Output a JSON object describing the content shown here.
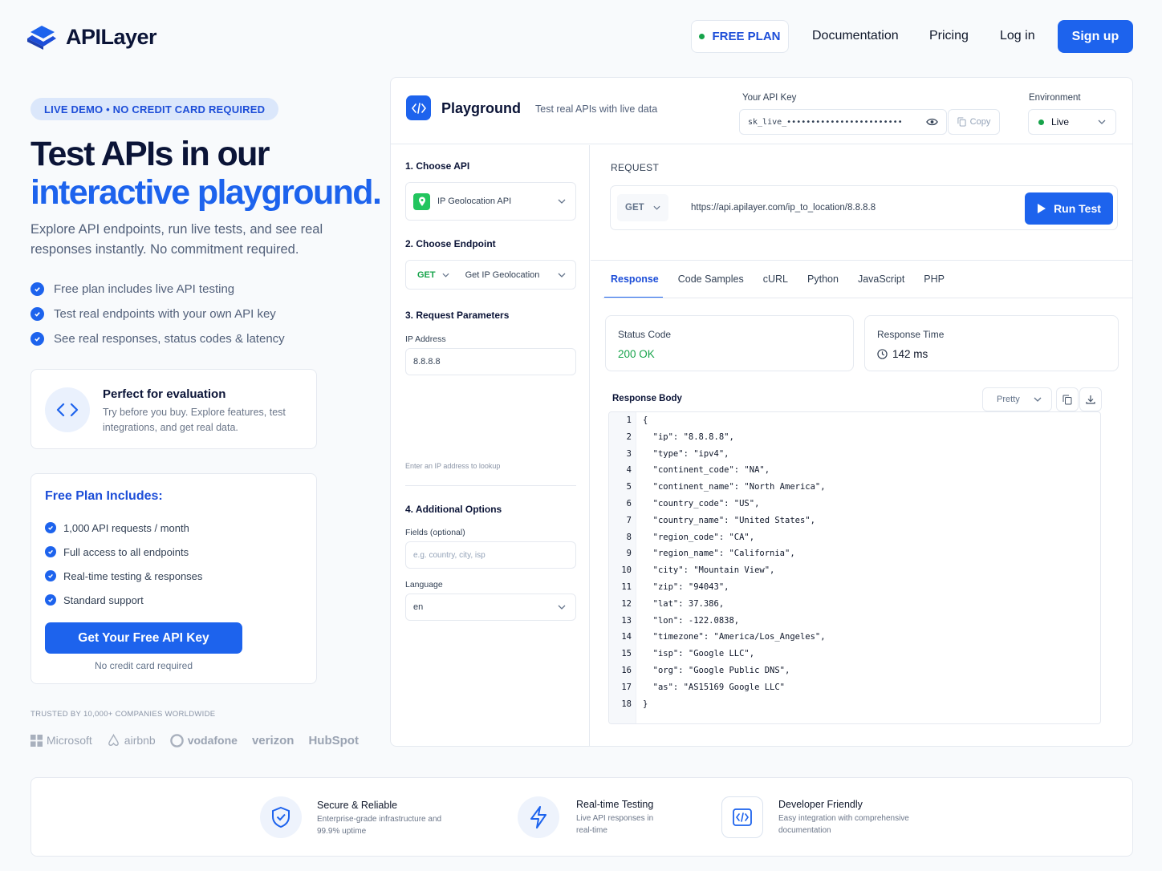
{
  "header": {
    "brand": "APILayer",
    "free_plan": "FREE PLAN",
    "nav": [
      "Documentation",
      "Pricing",
      "Log in"
    ],
    "signup": "Sign up"
  },
  "hero": {
    "badge": "LIVE DEMO • NO CREDIT CARD REQUIRED",
    "title_line1": "Test APIs in our",
    "title_line2": "interactive playground.",
    "lead": "Explore API endpoints, run live tests, and see real responses instantly. No commitment required.",
    "bullets": [
      "Free plan includes live API testing",
      "Test real endpoints with your own API key",
      "See real responses, status codes & latency"
    ]
  },
  "evaluation": {
    "title": "Perfect for evaluation",
    "desc": "Try before you buy. Explore features, test integrations, and get real data."
  },
  "plan": {
    "title": "Free Plan Includes:",
    "items": [
      "1,000 API requests / month",
      "Full access to all endpoints",
      "Real-time testing & responses",
      "Standard support"
    ],
    "cta": "Get Your Free API Key",
    "note": "No credit card required"
  },
  "trusted": {
    "label": "TRUSTED BY 10,000+ COMPANIES WORLDWIDE",
    "brands": [
      "Microsoft",
      "airbnb",
      "vodafone",
      "verizon",
      "HubSpot"
    ]
  },
  "playground": {
    "title": "Playground",
    "subtitle": "Test real APIs with live data",
    "api_key_label": "Your API Key",
    "api_key_value": "sk_live_••••••••••••••••••••••••",
    "copy": "Copy",
    "env_label": "Environment",
    "env_value": "Live",
    "step1": "1. Choose API",
    "api_value": "IP Geolocation API",
    "step2": "2. Choose Endpoint",
    "endpoint_method": "GET",
    "endpoint_value": "Get IP Geolocation",
    "step3": "3. Request Parameters",
    "ip_label": "IP Address",
    "ip_value": "8.8.8.8",
    "ip_hint": "Enter an IP address to lookup",
    "step4": "4. Additional Options",
    "fields_label": "Fields (optional)",
    "fields_placeholder": "e.g. country, city, isp",
    "language_label": "Language",
    "language_value": "en",
    "request_label": "REQUEST",
    "request_method": "GET",
    "request_url": "https://api.apilayer.com/ip_to_location/8.8.8.8",
    "run": "Run Test",
    "tabs": [
      "Response",
      "Code Samples",
      "cURL",
      "Python",
      "JavaScript",
      "PHP"
    ],
    "status_label": "Status Code",
    "status_value": "200 OK",
    "time_label": "Response Time",
    "time_value": "142 ms",
    "body_label": "Response Body",
    "format": "Pretty",
    "code_lines": [
      "{",
      "  \"ip\": \"8.8.8.8\",",
      "  \"type\": \"ipv4\",",
      "  \"continent_code\": \"NA\",",
      "  \"continent_name\": \"North America\",",
      "  \"country_code\": \"US\",",
      "  \"country_name\": \"United States\",",
      "  \"region_code\": \"CA\",",
      "  \"region_name\": \"California\",",
      "  \"city\": \"Mountain View\",",
      "  \"zip\": \"94043\",",
      "  \"lat\": 37.386,",
      "  \"lon\": -122.0838,",
      "  \"timezone\": \"America/Los_Angeles\",",
      "  \"isp\": \"Google LLC\",",
      "  \"org\": \"Google Public DNS\",",
      "  \"as\": \"AS15169 Google LLC\"",
      "}"
    ]
  },
  "features": [
    {
      "title": "Secure & Reliable",
      "desc": "Enterprise-grade infrastructure and 99.9% uptime",
      "icon": "shield-icon"
    },
    {
      "title": "Real-time Testing",
      "desc": "Live API responses in real-time",
      "icon": "lightning-icon"
    },
    {
      "title": "Developer Friendly",
      "desc": "Easy integration with comprehensive documentation",
      "icon": "code-icon"
    }
  ],
  "colors": {
    "accent": "#1d63ed",
    "success": "#16a34a",
    "navy": "#0b1437"
  }
}
